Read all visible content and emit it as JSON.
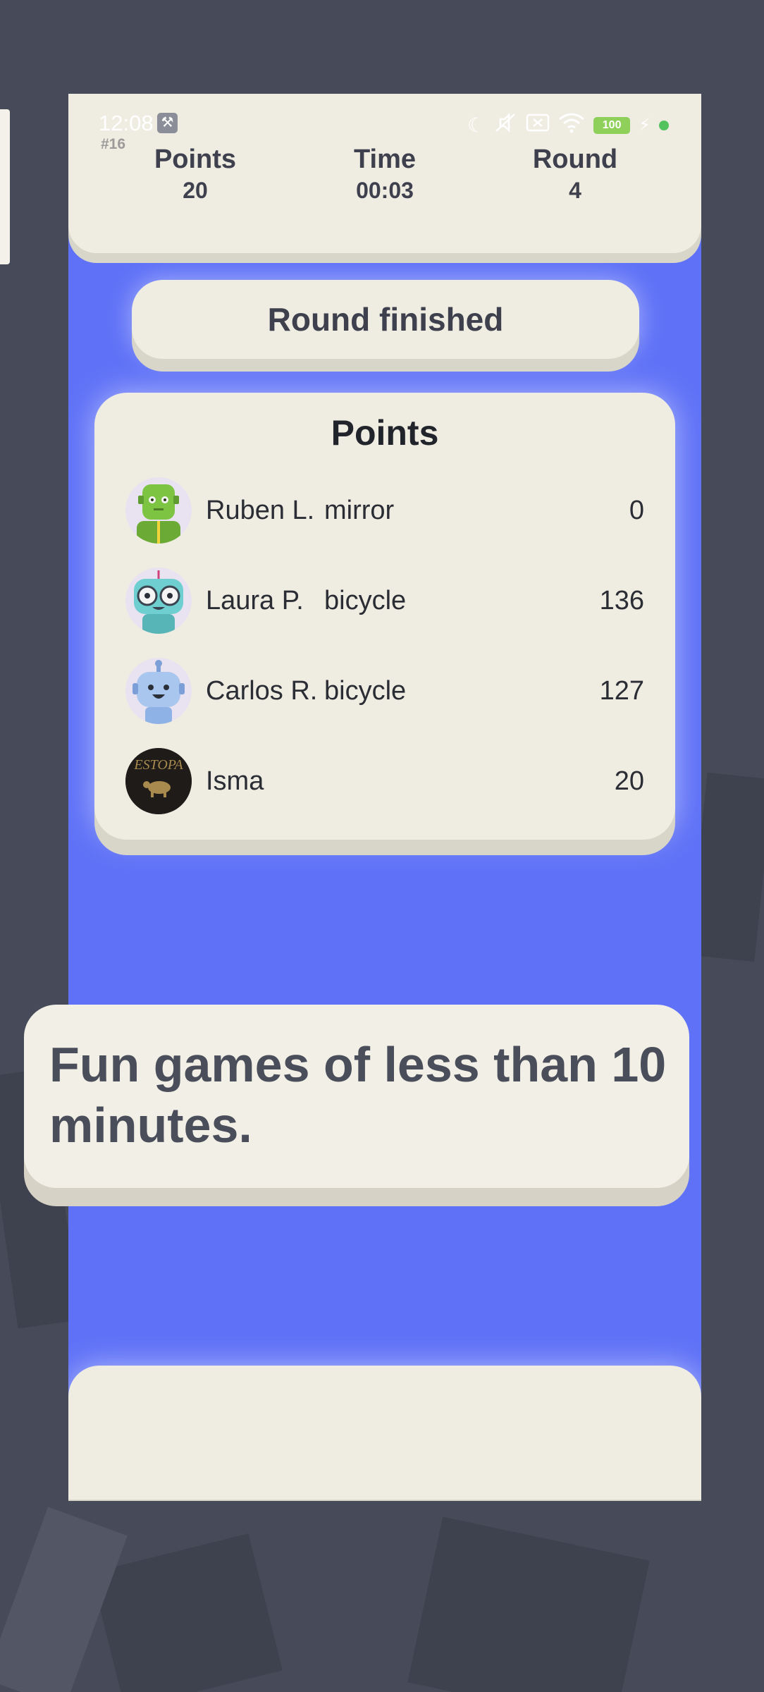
{
  "status_bar": {
    "time": "12:08",
    "battery": "100"
  },
  "header": {
    "match_id": "#16",
    "stats": [
      {
        "label": "Points",
        "value": "20"
      },
      {
        "label": "Time",
        "value": "00:03"
      },
      {
        "label": "Round",
        "value": "4"
      }
    ]
  },
  "banner": {
    "title": "Round finished"
  },
  "points_card": {
    "title": "Points",
    "players": [
      {
        "name": "Ruben L.",
        "word": "mirror",
        "score": "0",
        "avatar": "green-robot-avatar"
      },
      {
        "name": "Laura P.",
        "word": "bicycle",
        "score": "136",
        "avatar": "teal-robot-avatar"
      },
      {
        "name": "Carlos R.",
        "word": "bicycle",
        "score": "127",
        "avatar": "blue-robot-avatar"
      },
      {
        "name": "Isma",
        "word": "",
        "score": "20",
        "avatar": "estopa-logo-avatar",
        "avatar_text": "ESTOPA"
      }
    ]
  },
  "caption": {
    "text": "Fun games of less than 10 minutes."
  },
  "colors": {
    "background": "#474a58",
    "game_blue": "#5f72f7",
    "card": "#efece2",
    "text_dark": "#3e414d"
  }
}
